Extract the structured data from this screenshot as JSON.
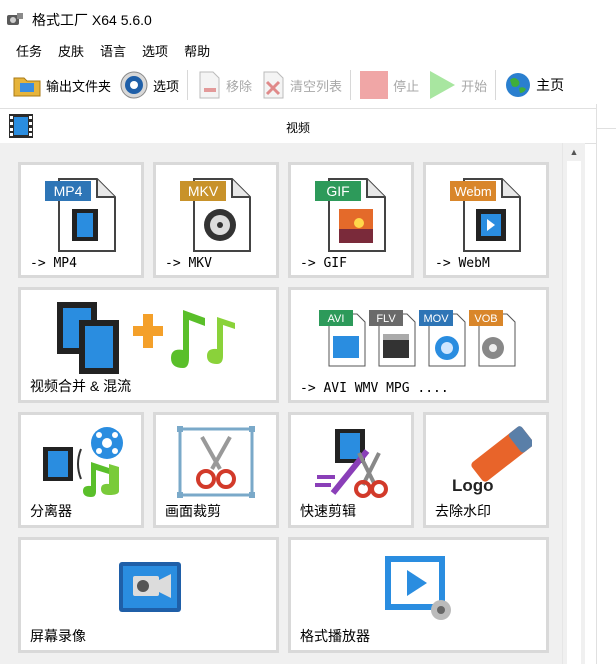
{
  "window": {
    "title": "格式工厂 X64 5.6.0"
  },
  "menu": [
    "任务",
    "皮肤",
    "语言",
    "选项",
    "帮助"
  ],
  "toolbar": {
    "output_folder": "输出文件夹",
    "options": "选项",
    "remove": "移除",
    "clear_list": "清空列表",
    "stop": "停止",
    "start": "开始",
    "home": "主页"
  },
  "section": {
    "title": "视频"
  },
  "tiles": {
    "mp4": "-> MP4",
    "mkv": "-> MKV",
    "gif": "-> GIF",
    "webm": "-> WebM",
    "merge": "视频合并 & 混流",
    "avi": "-> AVI WMV MPG ....",
    "splitter": "分离器",
    "crop": "画面裁剪",
    "fastcut": "快速剪辑",
    "watermark": "去除水印",
    "recorder": "屏幕录像",
    "player": "格式播放器"
  },
  "badges": {
    "mp4": "MP4",
    "mkv": "MKV",
    "gif": "GIF",
    "webm": "Webm",
    "avi": "AVI",
    "flv": "FLV",
    "mov": "MOV",
    "vob": "VOB",
    "logo": "Logo"
  },
  "colors": {
    "mp4": "#2e75b6",
    "mkv": "#c8922a",
    "gif": "#2d9a5a",
    "webm": "#d9862a",
    "tile_border": "#d9d9d9"
  }
}
